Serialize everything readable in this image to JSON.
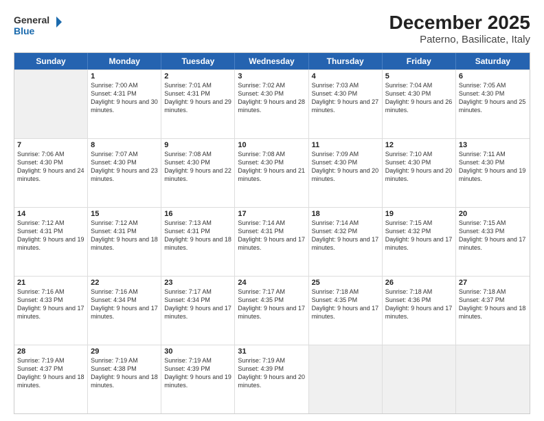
{
  "logo": {
    "general": "General",
    "blue": "Blue"
  },
  "title": "December 2025",
  "subtitle": "Paterno, Basilicate, Italy",
  "headers": [
    "Sunday",
    "Monday",
    "Tuesday",
    "Wednesday",
    "Thursday",
    "Friday",
    "Saturday"
  ],
  "weeks": [
    [
      {
        "day": "",
        "sunrise": "",
        "sunset": "",
        "daylight": "",
        "shaded": true
      },
      {
        "day": "1",
        "sunrise": "Sunrise: 7:00 AM",
        "sunset": "Sunset: 4:31 PM",
        "daylight": "Daylight: 9 hours and 30 minutes."
      },
      {
        "day": "2",
        "sunrise": "Sunrise: 7:01 AM",
        "sunset": "Sunset: 4:31 PM",
        "daylight": "Daylight: 9 hours and 29 minutes."
      },
      {
        "day": "3",
        "sunrise": "Sunrise: 7:02 AM",
        "sunset": "Sunset: 4:30 PM",
        "daylight": "Daylight: 9 hours and 28 minutes."
      },
      {
        "day": "4",
        "sunrise": "Sunrise: 7:03 AM",
        "sunset": "Sunset: 4:30 PM",
        "daylight": "Daylight: 9 hours and 27 minutes."
      },
      {
        "day": "5",
        "sunrise": "Sunrise: 7:04 AM",
        "sunset": "Sunset: 4:30 PM",
        "daylight": "Daylight: 9 hours and 26 minutes."
      },
      {
        "day": "6",
        "sunrise": "Sunrise: 7:05 AM",
        "sunset": "Sunset: 4:30 PM",
        "daylight": "Daylight: 9 hours and 25 minutes."
      }
    ],
    [
      {
        "day": "7",
        "sunrise": "Sunrise: 7:06 AM",
        "sunset": "Sunset: 4:30 PM",
        "daylight": "Daylight: 9 hours and 24 minutes."
      },
      {
        "day": "8",
        "sunrise": "Sunrise: 7:07 AM",
        "sunset": "Sunset: 4:30 PM",
        "daylight": "Daylight: 9 hours and 23 minutes."
      },
      {
        "day": "9",
        "sunrise": "Sunrise: 7:08 AM",
        "sunset": "Sunset: 4:30 PM",
        "daylight": "Daylight: 9 hours and 22 minutes."
      },
      {
        "day": "10",
        "sunrise": "Sunrise: 7:08 AM",
        "sunset": "Sunset: 4:30 PM",
        "daylight": "Daylight: 9 hours and 21 minutes."
      },
      {
        "day": "11",
        "sunrise": "Sunrise: 7:09 AM",
        "sunset": "Sunset: 4:30 PM",
        "daylight": "Daylight: 9 hours and 20 minutes."
      },
      {
        "day": "12",
        "sunrise": "Sunrise: 7:10 AM",
        "sunset": "Sunset: 4:30 PM",
        "daylight": "Daylight: 9 hours and 20 minutes."
      },
      {
        "day": "13",
        "sunrise": "Sunrise: 7:11 AM",
        "sunset": "Sunset: 4:30 PM",
        "daylight": "Daylight: 9 hours and 19 minutes."
      }
    ],
    [
      {
        "day": "14",
        "sunrise": "Sunrise: 7:12 AM",
        "sunset": "Sunset: 4:31 PM",
        "daylight": "Daylight: 9 hours and 19 minutes."
      },
      {
        "day": "15",
        "sunrise": "Sunrise: 7:12 AM",
        "sunset": "Sunset: 4:31 PM",
        "daylight": "Daylight: 9 hours and 18 minutes."
      },
      {
        "day": "16",
        "sunrise": "Sunrise: 7:13 AM",
        "sunset": "Sunset: 4:31 PM",
        "daylight": "Daylight: 9 hours and 18 minutes."
      },
      {
        "day": "17",
        "sunrise": "Sunrise: 7:14 AM",
        "sunset": "Sunset: 4:31 PM",
        "daylight": "Daylight: 9 hours and 17 minutes."
      },
      {
        "day": "18",
        "sunrise": "Sunrise: 7:14 AM",
        "sunset": "Sunset: 4:32 PM",
        "daylight": "Daylight: 9 hours and 17 minutes."
      },
      {
        "day": "19",
        "sunrise": "Sunrise: 7:15 AM",
        "sunset": "Sunset: 4:32 PM",
        "daylight": "Daylight: 9 hours and 17 minutes."
      },
      {
        "day": "20",
        "sunrise": "Sunrise: 7:15 AM",
        "sunset": "Sunset: 4:33 PM",
        "daylight": "Daylight: 9 hours and 17 minutes."
      }
    ],
    [
      {
        "day": "21",
        "sunrise": "Sunrise: 7:16 AM",
        "sunset": "Sunset: 4:33 PM",
        "daylight": "Daylight: 9 hours and 17 minutes."
      },
      {
        "day": "22",
        "sunrise": "Sunrise: 7:16 AM",
        "sunset": "Sunset: 4:34 PM",
        "daylight": "Daylight: 9 hours and 17 minutes."
      },
      {
        "day": "23",
        "sunrise": "Sunrise: 7:17 AM",
        "sunset": "Sunset: 4:34 PM",
        "daylight": "Daylight: 9 hours and 17 minutes."
      },
      {
        "day": "24",
        "sunrise": "Sunrise: 7:17 AM",
        "sunset": "Sunset: 4:35 PM",
        "daylight": "Daylight: 9 hours and 17 minutes."
      },
      {
        "day": "25",
        "sunrise": "Sunrise: 7:18 AM",
        "sunset": "Sunset: 4:35 PM",
        "daylight": "Daylight: 9 hours and 17 minutes."
      },
      {
        "day": "26",
        "sunrise": "Sunrise: 7:18 AM",
        "sunset": "Sunset: 4:36 PM",
        "daylight": "Daylight: 9 hours and 17 minutes."
      },
      {
        "day": "27",
        "sunrise": "Sunrise: 7:18 AM",
        "sunset": "Sunset: 4:37 PM",
        "daylight": "Daylight: 9 hours and 18 minutes."
      }
    ],
    [
      {
        "day": "28",
        "sunrise": "Sunrise: 7:19 AM",
        "sunset": "Sunset: 4:37 PM",
        "daylight": "Daylight: 9 hours and 18 minutes."
      },
      {
        "day": "29",
        "sunrise": "Sunrise: 7:19 AM",
        "sunset": "Sunset: 4:38 PM",
        "daylight": "Daylight: 9 hours and 18 minutes."
      },
      {
        "day": "30",
        "sunrise": "Sunrise: 7:19 AM",
        "sunset": "Sunset: 4:39 PM",
        "daylight": "Daylight: 9 hours and 19 minutes."
      },
      {
        "day": "31",
        "sunrise": "Sunrise: 7:19 AM",
        "sunset": "Sunset: 4:39 PM",
        "daylight": "Daylight: 9 hours and 20 minutes."
      },
      {
        "day": "",
        "sunrise": "",
        "sunset": "",
        "daylight": "",
        "shaded": true
      },
      {
        "day": "",
        "sunrise": "",
        "sunset": "",
        "daylight": "",
        "shaded": true
      },
      {
        "day": "",
        "sunrise": "",
        "sunset": "",
        "daylight": "",
        "shaded": true
      }
    ]
  ]
}
